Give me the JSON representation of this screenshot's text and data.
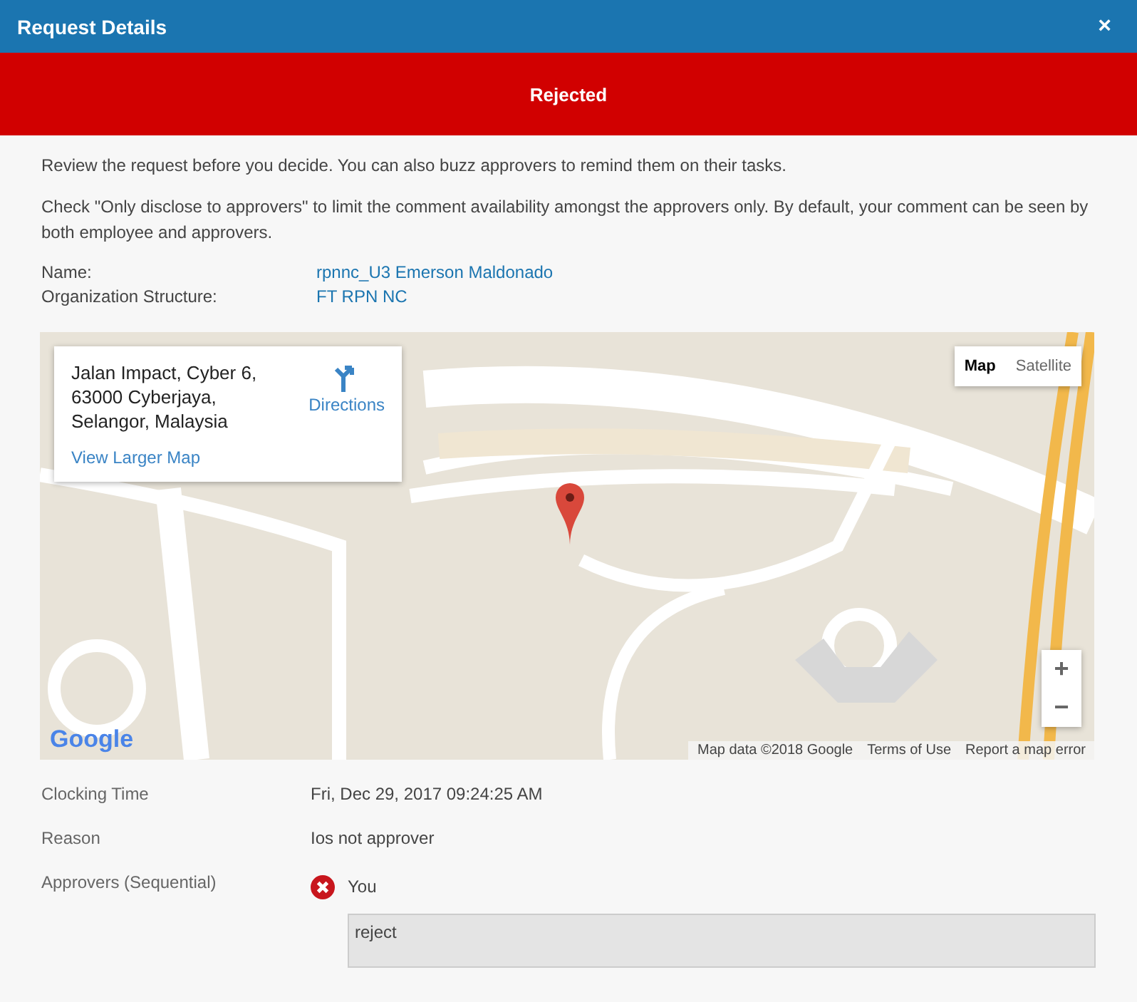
{
  "window": {
    "title": "Request Details",
    "close": "×"
  },
  "status_banner": {
    "label": "Rejected",
    "kind": "rejected"
  },
  "intro": [
    "Review the request before you decide. You can also buzz approvers to remind them on their tasks.",
    "Check \"Only disclose to approvers\" to limit the comment availability amongst the approvers only. By default, your comment can be seen by both employee and approvers."
  ],
  "employee": [
    {
      "label": "Name:",
      "value": "rpnnc_U3 Emerson Maldonado"
    },
    {
      "label": "Organization Structure:",
      "value": "FT RPN NC"
    }
  ],
  "map": {
    "info_card": {
      "address": [
        "Jalan Impact, Cyber 6,",
        "63000 Cyberjaya,",
        "Selangor, Malaysia"
      ],
      "directions": "Directions",
      "larger_map": "View Larger Map"
    },
    "map_types": [
      {
        "label": "Map",
        "selected": true
      },
      {
        "label": "Satellite",
        "selected": false
      }
    ],
    "zoom": [
      "+",
      "−"
    ],
    "logo": "Google",
    "attribution": [
      "Map data ©2018 Google",
      "Terms of Use",
      "Report a map error"
    ]
  },
  "details": [
    {
      "label": "Clocking Time",
      "value": "Fri, Dec 29, 2017 09:24:25 AM"
    },
    {
      "label": "Reason",
      "value": "Ios not approver"
    }
  ],
  "approvers": {
    "label": "Approvers (Sequential)",
    "items": [
      {
        "name": "You",
        "rejected": true,
        "comment": "reject"
      }
    ]
  }
}
